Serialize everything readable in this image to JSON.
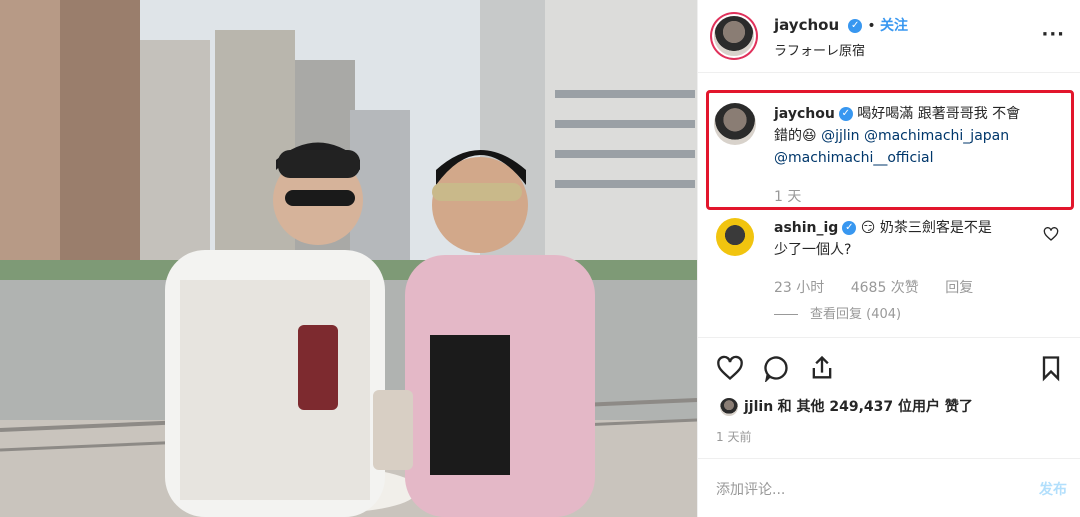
{
  "post": {
    "username": "jaychou",
    "follow_label": "关注",
    "location": "ラフォーレ原宿",
    "more_label": "···"
  },
  "caption": {
    "username": "jaychou",
    "line1": "喝好喝滿 跟著哥哥我 不會",
    "line2_prefix": "錯的",
    "emoji": "😆",
    "mention1": "@jjlin",
    "mention2": "@machimachi_japan",
    "mention3": "@machimachi__official",
    "time": "1 天"
  },
  "comment": {
    "username": "ashin_ig",
    "emoji": "😏",
    "line1": "奶茶三劍客是不是",
    "line2": "少了一個人?",
    "time": "23 小时",
    "likes": "4685 次赞",
    "reply_label": "回复",
    "view_replies": "查看回复 (404)"
  },
  "likes": {
    "user": "jjlin",
    "text": "和 其他 249,437 位用户 赞了"
  },
  "posted_time": "1 天前",
  "add_comment": {
    "placeholder": "添加评论...",
    "post_label": "发布"
  },
  "icons": [
    "heart-icon",
    "comment-icon",
    "share-icon",
    "bookmark-icon",
    "verified-icon",
    "more-icon"
  ],
  "colors": {
    "accent": "#3897f0",
    "highlight_box": "#e2162c",
    "muted": "#999999"
  }
}
